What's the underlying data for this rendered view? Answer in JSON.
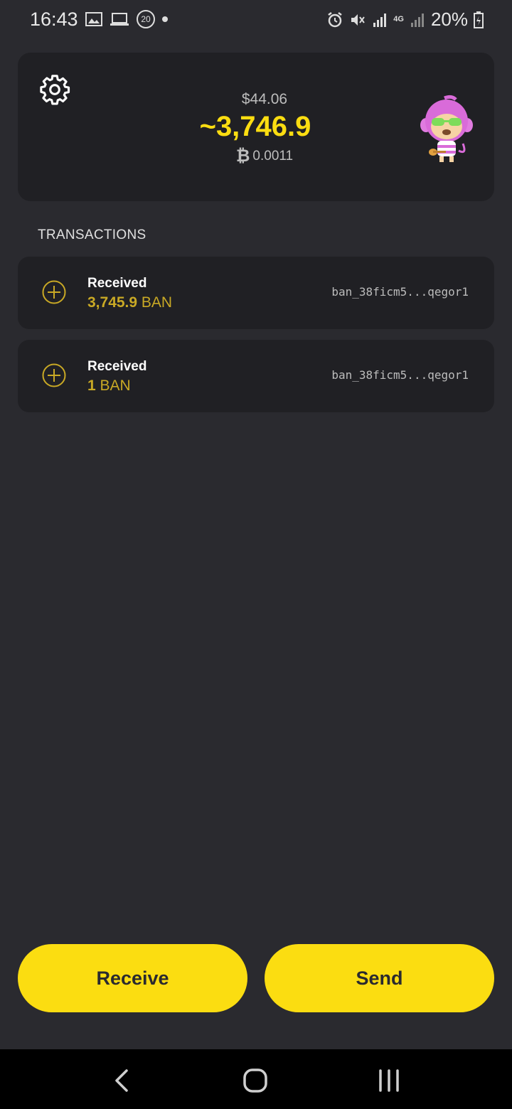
{
  "status_bar": {
    "time": "16:43",
    "notification_count": "20",
    "network": "4G",
    "battery": "20%",
    "icons": [
      "image-icon",
      "laptop-icon",
      "alarm-icon",
      "mute-icon",
      "signal-icon",
      "battery-icon"
    ]
  },
  "wallet": {
    "fiat_balance": "$44.06",
    "balance": "~3,746.9",
    "btc_balance": "0.0011",
    "btc_symbol": "₿"
  },
  "transactions": {
    "title": "TRANSACTIONS",
    "items": [
      {
        "type": "Received",
        "amount": "3,745.9",
        "unit": "BAN",
        "address": "ban_38ficm5...qegor1"
      },
      {
        "type": "Received",
        "amount": "1",
        "unit": "BAN",
        "address": "ban_38ficm5...qegor1"
      }
    ]
  },
  "actions": {
    "receive_label": "Receive",
    "send_label": "Send"
  },
  "colors": {
    "accent": "#fbdd11",
    "background": "#2a2a2f",
    "card": "#202024",
    "amount": "#c9a925"
  }
}
